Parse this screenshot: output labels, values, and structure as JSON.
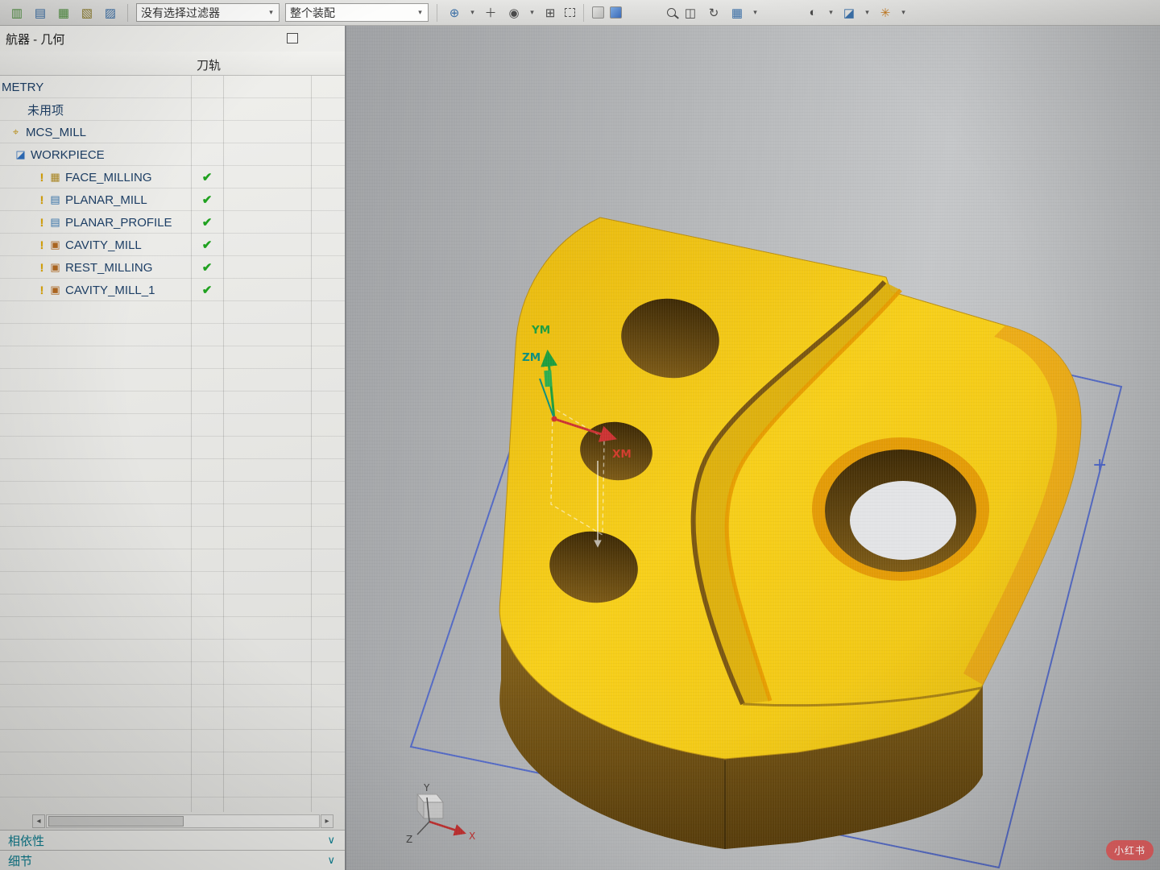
{
  "toolbar": {
    "filter_combo": "没有选择过滤器",
    "scope_combo": "整个装配"
  },
  "navigator": {
    "title": "航器 - 几何",
    "column_header": "刀轨",
    "rows": [
      {
        "label": "METRY",
        "check": ""
      },
      {
        "label": "未用项",
        "check": ""
      },
      {
        "label": "MCS_MILL",
        "check": ""
      },
      {
        "label": "WORKPIECE",
        "check": ""
      },
      {
        "label": "FACE_MILLING",
        "check": "✔"
      },
      {
        "label": "PLANAR_MILL",
        "check": "✔"
      },
      {
        "label": "PLANAR_PROFILE",
        "check": "✔"
      },
      {
        "label": "CAVITY_MILL",
        "check": "✔"
      },
      {
        "label": "REST_MILLING",
        "check": "✔"
      },
      {
        "label": "CAVITY_MILL_1",
        "check": "✔"
      }
    ],
    "dependencies_label": "相依性",
    "details_label": "细节"
  },
  "viewport": {
    "axes": {
      "ym": "YM",
      "zm": "ZM",
      "xm": "XM"
    },
    "triad": {
      "x": "X",
      "y": "Y",
      "z": "Z"
    },
    "plus_marker": "+"
  },
  "watermark": "小红书",
  "colors": {
    "part_top": "#f2c71b",
    "part_side": "#7a5514",
    "stock_wireframe": "#4a63c8",
    "check_green": "#1fa11f"
  }
}
